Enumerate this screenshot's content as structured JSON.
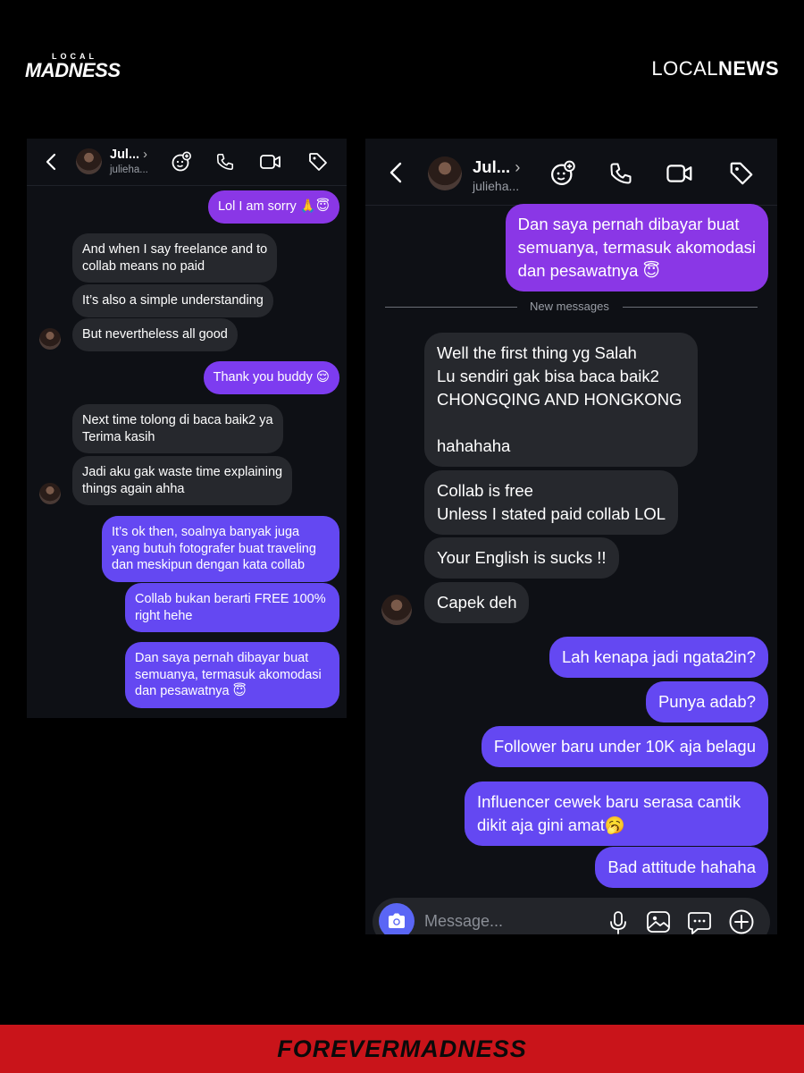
{
  "brand": {
    "left_small": "LOCAL",
    "left_big": "MADNESS",
    "right_light": "LOCAL",
    "right_bold": "NEWS"
  },
  "footer": {
    "text": "FOREVERMADNESS"
  },
  "screenshot_left": {
    "header": {
      "name": "Jul...",
      "username": "julieha..."
    },
    "messages": [
      {
        "side": "out",
        "text": "Lol I am sorry 🙏😇"
      },
      {
        "side": "in",
        "text": "And when I say freelance and to\ncollab means no paid"
      },
      {
        "side": "in",
        "text": "It’s also a simple understanding"
      },
      {
        "side": "in",
        "text": "But nevertheless all good"
      },
      {
        "side": "out",
        "text": "Thank you buddy 😌"
      },
      {
        "side": "in",
        "text": "Next time tolong di baca baik2 ya\nTerima kasih"
      },
      {
        "side": "in",
        "text": "Jadi aku gak waste time explaining\nthings again ahha"
      },
      {
        "side": "out",
        "text": "It’s ok then, soalnya banyak juga\nyang butuh fotografer buat traveling\ndan meskipun dengan kata collab"
      },
      {
        "side": "out",
        "text": "Collab bukan berarti FREE 100%\nright hehe"
      },
      {
        "side": "out",
        "text": "Dan saya pernah dibayar buat\nsemuanya, termasuk akomodasi\ndan pesawatnya 😇"
      }
    ]
  },
  "screenshot_right": {
    "header": {
      "name": "Jul...",
      "username": "julieha..."
    },
    "separator": "New messages",
    "messages": [
      {
        "side": "out",
        "text": "Dan saya pernah dibayar buat\nsemuanya, termasuk akomodasi\ndan pesawatnya 😇"
      },
      {
        "side": "in",
        "text": "Well the first thing yg Salah\nLu sendiri gak bisa baca baik2\nCHONGQING AND HONGKONG\n\nhahahaha"
      },
      {
        "side": "in",
        "text": "Collab is free\nUnless I stated paid collab LOL"
      },
      {
        "side": "in",
        "text": "Your English is sucks !!"
      },
      {
        "side": "in",
        "text": "Capek deh"
      },
      {
        "side": "out",
        "text": "Lah kenapa jadi ngata2in?"
      },
      {
        "side": "out",
        "text": "Punya adab?"
      },
      {
        "side": "out",
        "text": "Follower baru under 10K aja belagu"
      },
      {
        "side": "out",
        "text": "Influencer cewek baru serasa cantik\ndikit aja gini amat🥱"
      },
      {
        "side": "out",
        "text": "Bad attitude hahaha"
      }
    ],
    "composer": {
      "placeholder": "Message..."
    }
  },
  "icons": {
    "back": "chevron-left-icon",
    "chevron": "chevron-right-icon",
    "effects": "effects-icon",
    "call": "phone-icon",
    "video": "video-icon",
    "tag": "tag-icon",
    "camera": "camera-icon",
    "mic": "microphone-icon",
    "gallery": "gallery-icon",
    "sticker": "sticker-icon",
    "plus": "plus-icon"
  }
}
